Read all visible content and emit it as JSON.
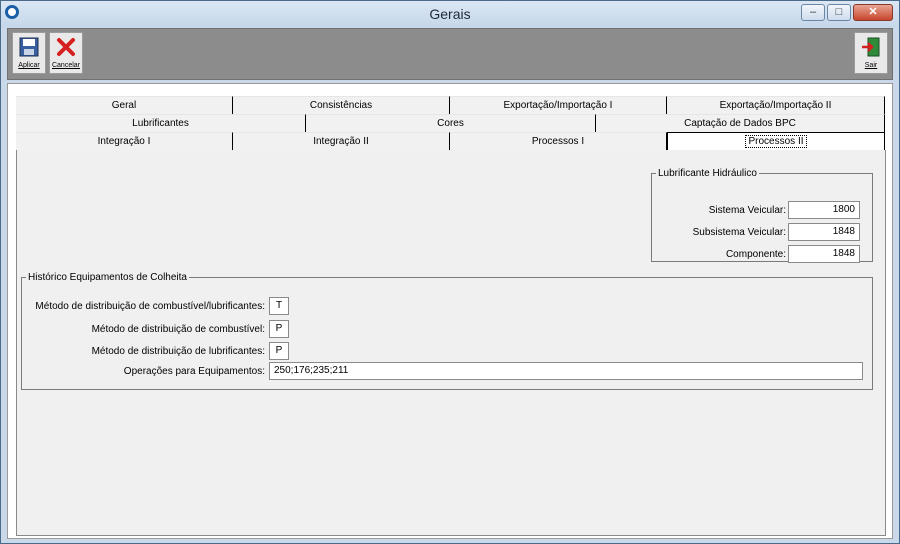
{
  "window": {
    "title": "Gerais",
    "buttons": {
      "minimize": "–",
      "maximize": "□",
      "close": "✕"
    }
  },
  "toolbar": {
    "apply_label": "Aplicar",
    "cancel_label": "Cancelar",
    "exit_label": "Sair"
  },
  "tabs": {
    "row1": [
      "Geral",
      "Consistências",
      "Exportação/Importação I",
      "Exportação/Importação II"
    ],
    "row2": [
      "Lubrificantes",
      "Cores",
      "Captação de Dados BPC"
    ],
    "row3": [
      "Integração I",
      "Integração II",
      "Processos I",
      "Processos II"
    ],
    "selected": "Processos II"
  },
  "lubrificante": {
    "legend": "Lubrificante Hidráulico",
    "sistema_label": "Sistema Veicular:",
    "sistema_value": "1800",
    "subsistema_label": "Subsistema Veicular:",
    "subsistema_value": "1848",
    "componente_label": "Componente:",
    "componente_value": "1848"
  },
  "historico": {
    "legend": "Histórico Equipamentos de Colheita",
    "metodo_comb_lub_label": "Método de distribuição de combustível/lubrificantes:",
    "metodo_comb_lub_value": "T",
    "metodo_comb_label": "Método de distribuição de combustível:",
    "metodo_comb_value": "P",
    "metodo_lub_label": "Método de distribuição de lubrificantes:",
    "metodo_lub_value": "P",
    "operacoes_label": "Operações para Equipamentos:",
    "operacoes_value": "250;176;235;211"
  },
  "colors": {
    "titlebar": "#c5d7ea",
    "toolbar": "#8c8c8c",
    "panel": "#f0f0f0",
    "close": "#c8452c"
  }
}
